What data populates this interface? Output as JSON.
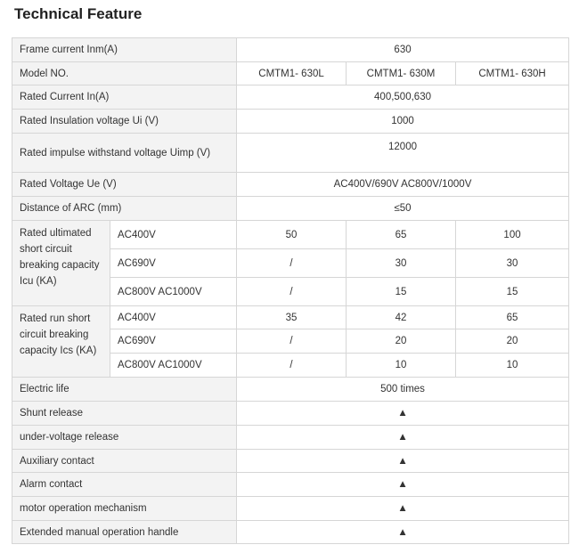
{
  "title": "Technical Feature",
  "rows": {
    "frame_current": {
      "label": "Frame current Inm(A)",
      "value": "630"
    },
    "model": {
      "label": "Model NO.",
      "values": [
        "CMTM1- 630L",
        "CMTM1- 630M",
        "CMTM1- 630H"
      ]
    },
    "rated_current": {
      "label": "Rated Current In(A)",
      "value": "400,500,630"
    },
    "insulation_voltage": {
      "label": "Rated Insulation voltage Ui (V)",
      "value": "1000"
    },
    "impulse_voltage": {
      "label": "Rated impulse withstand voltage Uimp (V)",
      "value": "12000"
    },
    "rated_voltage": {
      "label": "Rated Voltage Ue (V)",
      "value": "AC400V/690V AC800V/1000V"
    },
    "arc_distance": {
      "label": "Distance of ARC (mm)",
      "value": "≤50"
    },
    "icu": {
      "label": "Rated ultimated short circuit breaking capacity Icu (KA)",
      "lines": [
        {
          "voltage": "AC400V",
          "values": [
            "50",
            "65",
            "100"
          ]
        },
        {
          "voltage": "AC690V",
          "values": [
            "/",
            "30",
            "30"
          ]
        },
        {
          "voltage": "AC800V AC1000V",
          "values": [
            "/",
            "15",
            "15"
          ]
        }
      ]
    },
    "ics": {
      "label": "Rated run short circuit breaking capacity Ics (KA)",
      "lines": [
        {
          "voltage": "AC400V",
          "values": [
            "35",
            "42",
            "65"
          ]
        },
        {
          "voltage": "AC690V",
          "values": [
            "/",
            "20",
            "20"
          ]
        },
        {
          "voltage": "AC800V AC1000V",
          "values": [
            "/",
            "10",
            "10"
          ]
        }
      ]
    },
    "electric_life": {
      "label": "Electric life",
      "value": "500 times"
    },
    "shunt_release": {
      "label": "Shunt release",
      "value": "▲"
    },
    "undervoltage_release": {
      "label": "under-voltage release",
      "value": "▲"
    },
    "auxiliary_contact": {
      "label": "Auxiliary contact",
      "value": "▲"
    },
    "alarm_contact": {
      "label": "Alarm contact",
      "value": "▲"
    },
    "motor_mechanism": {
      "label": "motor operation mechanism",
      "value": "▲"
    },
    "manual_handle": {
      "label": "Extended manual operation handle",
      "value": "▲"
    }
  }
}
